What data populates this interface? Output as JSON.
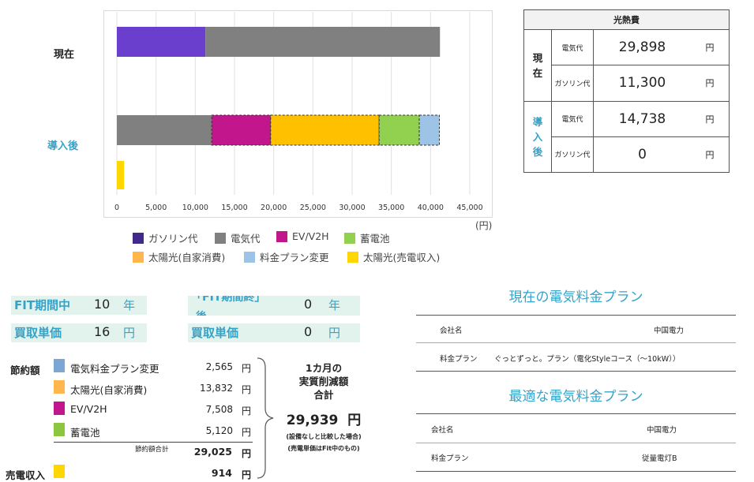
{
  "chart_data": {
    "type": "bar",
    "orientation": "horizontal",
    "stacked": true,
    "categories": [
      "現在",
      "導入後"
    ],
    "x_unit": "(円)",
    "xlim": [
      0,
      45000
    ],
    "x_ticks": [
      "0",
      "5,000",
      "10,000",
      "15,000",
      "20,000",
      "25,000",
      "30,000",
      "35,000",
      "40,000",
      "45,000"
    ],
    "grid": "vertical",
    "legend_position": "bottom",
    "series": [
      {
        "name": "ガソリン代",
        "color": "#6a3fce",
        "values": [
          11300,
          0
        ]
      },
      {
        "name": "電気代",
        "color": "#808080",
        "values": [
          29898,
          12100
        ]
      },
      {
        "name": "EV/V2H",
        "color": "#c2168c",
        "values": [
          0,
          7508
        ]
      },
      {
        "name": "太陽光(自家消費)",
        "color": "#ffc000",
        "values": [
          0,
          13832
        ]
      },
      {
        "name": "蓄電池",
        "color": "#92d050",
        "values": [
          0,
          5120
        ]
      },
      {
        "name": "料金プラン変更",
        "color": "#9dc3e6",
        "values": [
          0,
          2565
        ]
      },
      {
        "name": "太陽光(売電収入)",
        "color": "#ffd700",
        "values": [
          0,
          914
        ]
      }
    ],
    "legend_order": [
      "ガソリン代",
      "電気代",
      "EV/V2H",
      "蓄電池",
      "太陽光(自家消費)",
      "料金プラン変更",
      "太陽光(売電収入)"
    ],
    "legend_colors": [
      "#3f2a8c",
      "#808080",
      "#c2168c",
      "#92d050",
      "#ffb74d",
      "#9dc3e6",
      "#ffd700"
    ]
  },
  "cost_table": {
    "title": "光熱費",
    "groups": [
      {
        "label": [
          "現",
          "在"
        ],
        "color": "#222222",
        "rows": [
          {
            "item": "電気代",
            "value": "29,898",
            "unit": "円"
          },
          {
            "item": "ガソリン代",
            "value": "11,300",
            "unit": "円"
          }
        ]
      },
      {
        "label": [
          "導",
          "入",
          "後"
        ],
        "color": "#35a3c9",
        "rows": [
          {
            "item": "電気代",
            "value": "14,738",
            "unit": "円"
          },
          {
            "item": "ガソリン代",
            "value": "0",
            "unit": "円"
          }
        ]
      }
    ]
  },
  "fit": {
    "left": {
      "period_label": "FIT期間中",
      "period_value": "10",
      "period_unit": "年",
      "price_label": "買取単価",
      "price_value": "16",
      "price_unit": "円"
    },
    "right": {
      "period_label_top": "「FIT期間終」",
      "period_label_bottom": "後",
      "period_value": "0",
      "period_unit": "年",
      "price_label": "買取単価",
      "price_value": "0",
      "price_unit": "円"
    }
  },
  "savings": {
    "heading": "節約額",
    "items": [
      {
        "label": "電気料金プラン変更",
        "value": "2,565",
        "unit": "円",
        "color": "#7ba7d4"
      },
      {
        "label": "太陽光(自家消費)",
        "value": "13,832",
        "unit": "円",
        "color": "#ffb74d"
      },
      {
        "label": "EV/V2H",
        "value": "7,508",
        "unit": "円",
        "color": "#c2168c"
      },
      {
        "label": "蓄電池",
        "value": "5,120",
        "unit": "円",
        "color": "#8cc63f"
      }
    ],
    "total_label": "節約額合計",
    "total_value": "29,025",
    "total_unit": "円",
    "sale_label": "売電収入",
    "sale_value": "914",
    "sale_unit": "円",
    "sale_color": "#ffd700"
  },
  "summary": {
    "line1": "1カ月の",
    "line2": "実質削減額",
    "line3": "合計",
    "amount": "29,939",
    "unit": "円",
    "note1": "(設備なしと比較した場合)",
    "note2": "(売電単価はFit中のもの)"
  },
  "plans": {
    "current": {
      "title": "現在の電気料金プラン",
      "company_label": "会社名",
      "company": "中国電力",
      "plan_label": "料金プラン",
      "plan": "ぐっとずっと。プラン（電化Styleコース（～10kW））"
    },
    "optimal": {
      "title": "最適な電気料金プラン",
      "company_label": "会社名",
      "company": "中国電力",
      "plan_label": "料金プラン",
      "plan": "従量電灯B"
    }
  }
}
